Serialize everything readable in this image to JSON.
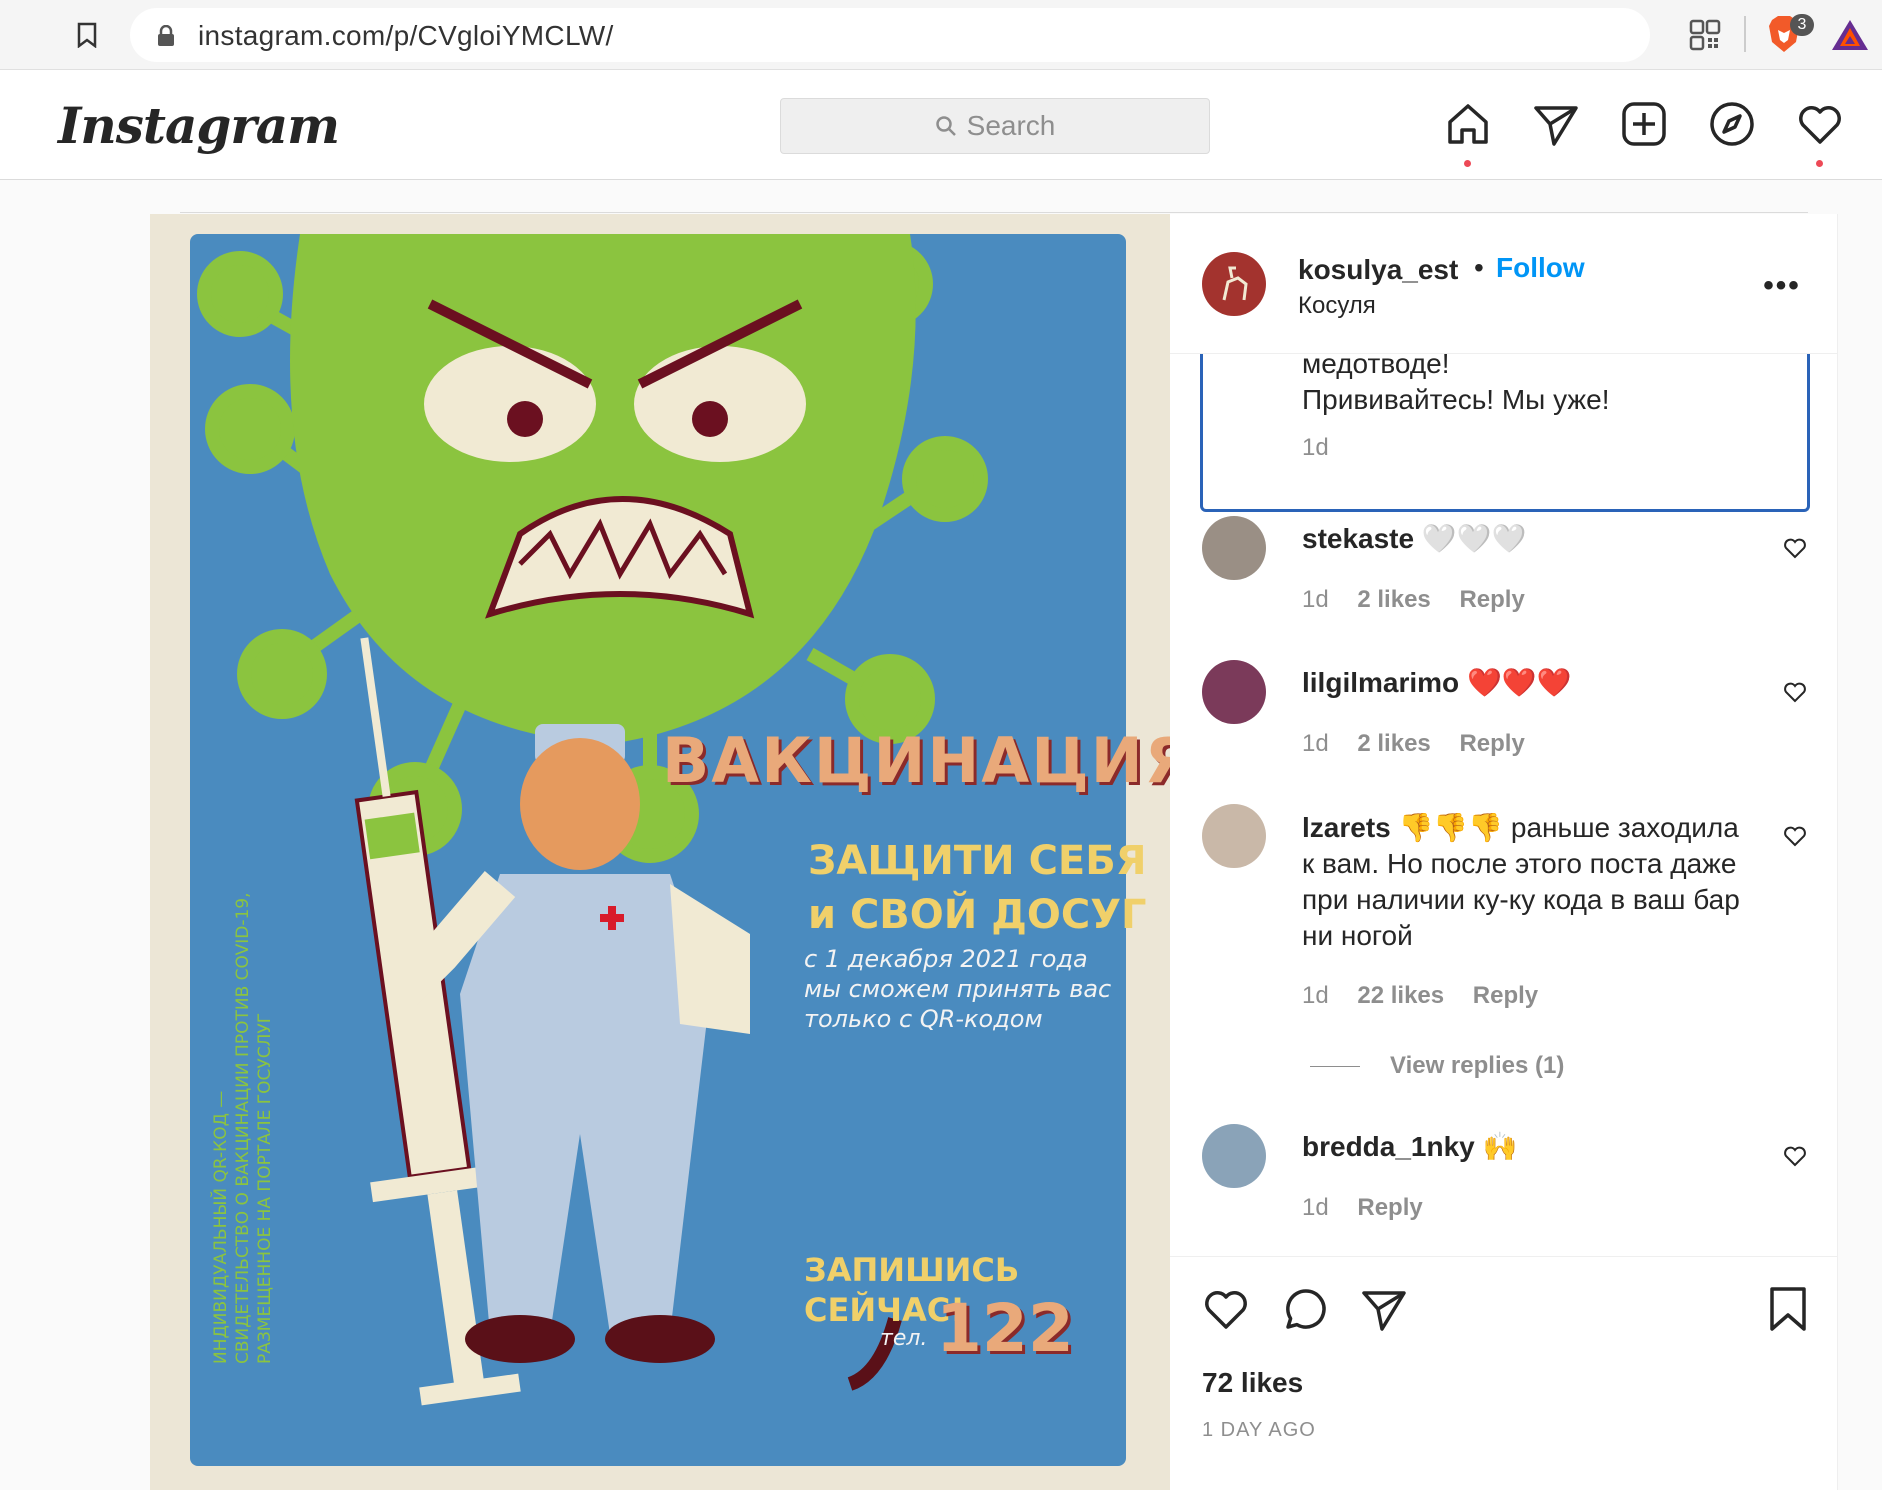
{
  "browser": {
    "url": "instagram.com/p/CVgloiYMCLW/",
    "extension_badge": "3"
  },
  "header": {
    "logo_text": "Instagram",
    "search_placeholder": "Search"
  },
  "post": {
    "owner": {
      "username": "kosulya_est",
      "follow_label": "Follow",
      "subtitle": "Косуля",
      "separator": "•"
    },
    "poster": {
      "title": "ВАКЦИНАЦИЯ",
      "sub_line1": "ЗАЩИТИ СЕБЯ",
      "sub_line2": "и СВОЙ ДОСУГ",
      "info_line1": "с 1  декабря 2021 года",
      "info_line2": "мы сможем принять вас",
      "info_line3": "только с QR-кодом",
      "cta_line1": "ЗАПИШИСЬ",
      "cta_line2": "СЕЙЧАС!",
      "tel_label": "тел.",
      "tel_number": "122",
      "vertical_line1": "ИНДИВИДУАЛЬНЫЙ QR-КОД —",
      "vertical_line2": "СВИДЕТЕЛЬСТВО О ВАКЦИНАЦИИ ПРОТИВ COVID-19,",
      "vertical_line3": "РАЗМЕЩЕННОЕ НА ПОРТАЛЕ ГОСУСЛУГ"
    },
    "caption": {
      "line1": "медотводе!",
      "line2": "Прививайтесь! Мы уже!",
      "time": "1d"
    },
    "comments": [
      {
        "user": "stekaste",
        "text": "🤍🤍🤍",
        "time": "1d",
        "likes": "2 likes",
        "reply": "Reply"
      },
      {
        "user": "lilgilmarimo",
        "text": "❤️❤️❤️",
        "time": "1d",
        "likes": "2 likes",
        "reply": "Reply"
      },
      {
        "user": "lzarets",
        "text_emoji": "👎👎👎",
        "text": "раньше заходила к вам. Но после этого поста даже при наличии ку-ку кода в ваш бар ни ногой",
        "time": "1d",
        "likes": "22 likes",
        "reply": "Reply",
        "view_replies": "View replies (1)"
      },
      {
        "user": "bredda_1nky",
        "text": "🙌",
        "time": "1d",
        "reply": "Reply"
      }
    ],
    "likes": "72 likes",
    "time_ago": "1 DAY AGO"
  },
  "colors": {
    "follow_blue": "#0095f6",
    "notification_red": "#ed4956",
    "highlight_border": "#2a63b8"
  }
}
